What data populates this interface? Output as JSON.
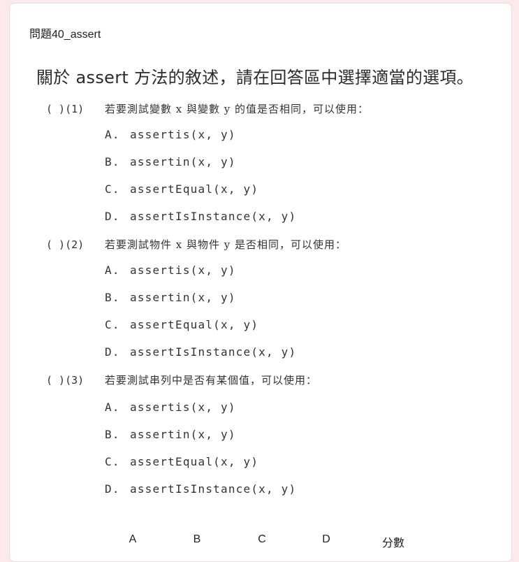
{
  "question": {
    "title": "問題40_assert",
    "intro": "關於 assert 方法的敘述，請在回答區中選擇適當的選項。",
    "subquestions": [
      {
        "number": "( )(1)",
        "prompt": "若要測試變數 x 與變數 y 的值是否相同，可以使用：",
        "options": [
          {
            "letter": "A.",
            "code": "assertis(x, y)"
          },
          {
            "letter": "B.",
            "code": "assertin(x, y)"
          },
          {
            "letter": "C.",
            "code": "assertEqual(x, y)"
          },
          {
            "letter": "D.",
            "code": "assertIsInstance(x, y)"
          }
        ]
      },
      {
        "number": "( )(2)",
        "prompt": "若要測試物件 x 與物件 y 是否相同，可以使用：",
        "options": [
          {
            "letter": "A.",
            "code": "assertis(x, y)"
          },
          {
            "letter": "B.",
            "code": "assertin(x, y)"
          },
          {
            "letter": "C.",
            "code": "assertEqual(x, y)"
          },
          {
            "letter": "D.",
            "code": "assertIsInstance(x, y)"
          }
        ]
      },
      {
        "number": "( )(3)",
        "prompt": "若要測試串列中是否有某個值，可以使用：",
        "options": [
          {
            "letter": "A.",
            "code": "assertis(x, y)"
          },
          {
            "letter": "B.",
            "code": "assertin(x, y)"
          },
          {
            "letter": "C.",
            "code": "assertEqual(x, y)"
          },
          {
            "letter": "D.",
            "code": "assertIsInstance(x, y)"
          }
        ]
      }
    ]
  },
  "grid": {
    "columns": [
      "A",
      "B",
      "C",
      "D",
      "分數"
    ]
  }
}
